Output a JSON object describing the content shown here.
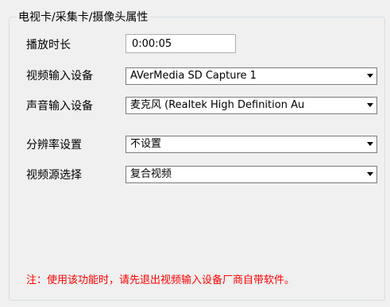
{
  "group": {
    "title": "电视卡/采集卡/摄像头属性"
  },
  "playback": {
    "label": "播放时长",
    "value": "0:00:05"
  },
  "video_input": {
    "label": "视频输入设备",
    "selected": "AVerMedia SD Capture 1"
  },
  "audio_input": {
    "label": "声音输入设备",
    "selected": "麦克风 (Realtek High Definition Au"
  },
  "resolution": {
    "label": "分辨率设置",
    "selected": "不设置"
  },
  "video_source": {
    "label": "视频源选择",
    "selected": "复合视频"
  },
  "note": "注：使用该功能时，请先退出视频输入设备厂商自带软件。"
}
